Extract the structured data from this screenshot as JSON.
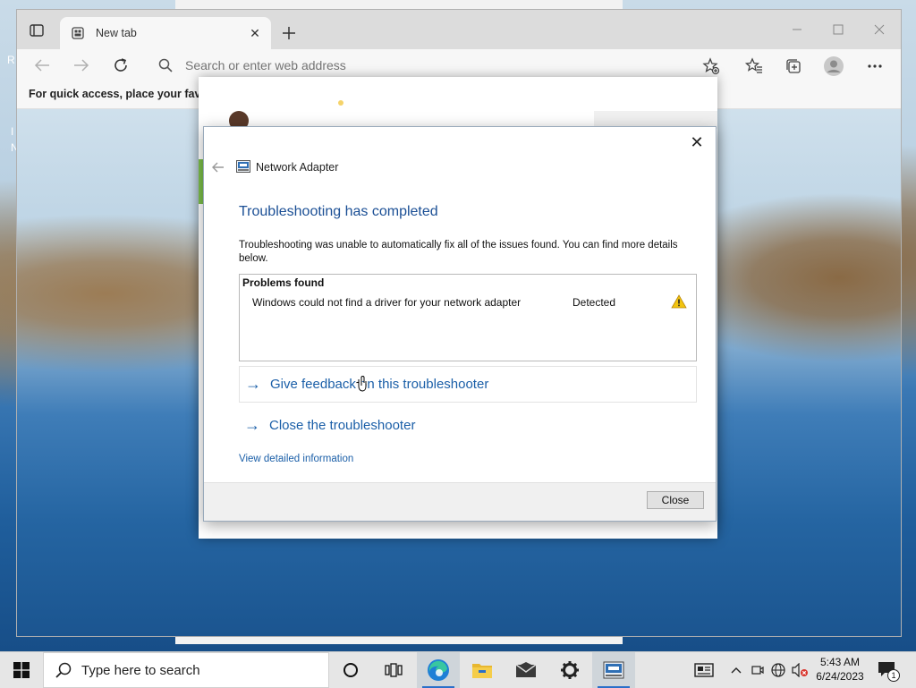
{
  "browser": {
    "tab_title": "New tab",
    "address_placeholder": "Search or enter web address",
    "favorites_hint": "For quick access, place your favorit"
  },
  "desktop": {
    "edge_letter_1": "R",
    "edge_letter_2": "I",
    "edge_letter_3": "N"
  },
  "dialog": {
    "app_title": "Network Adapter",
    "heading": "Troubleshooting has completed",
    "description": "Troubleshooting was unable to automatically fix all of the issues found. You can find more details below.",
    "problems_header": "Problems found",
    "problems": [
      {
        "text": "Windows could not find a driver for your network adapter",
        "status": "Detected"
      }
    ],
    "links": [
      {
        "arrow": "→",
        "label": "Give feedback on this troubleshooter"
      },
      {
        "arrow": "→",
        "label": "Close the troubleshooter"
      }
    ],
    "detail_link": "View detailed information",
    "close_button": "Close",
    "close_glyph": "✕"
  },
  "taskbar": {
    "search_text": "Type here to search",
    "time": "5:43 AM",
    "date": "6/24/2023",
    "notification_count": "1"
  },
  "colors": {
    "accent": "#1b5fa8",
    "heading": "#1b4f95",
    "warning": "#f2c40f"
  }
}
